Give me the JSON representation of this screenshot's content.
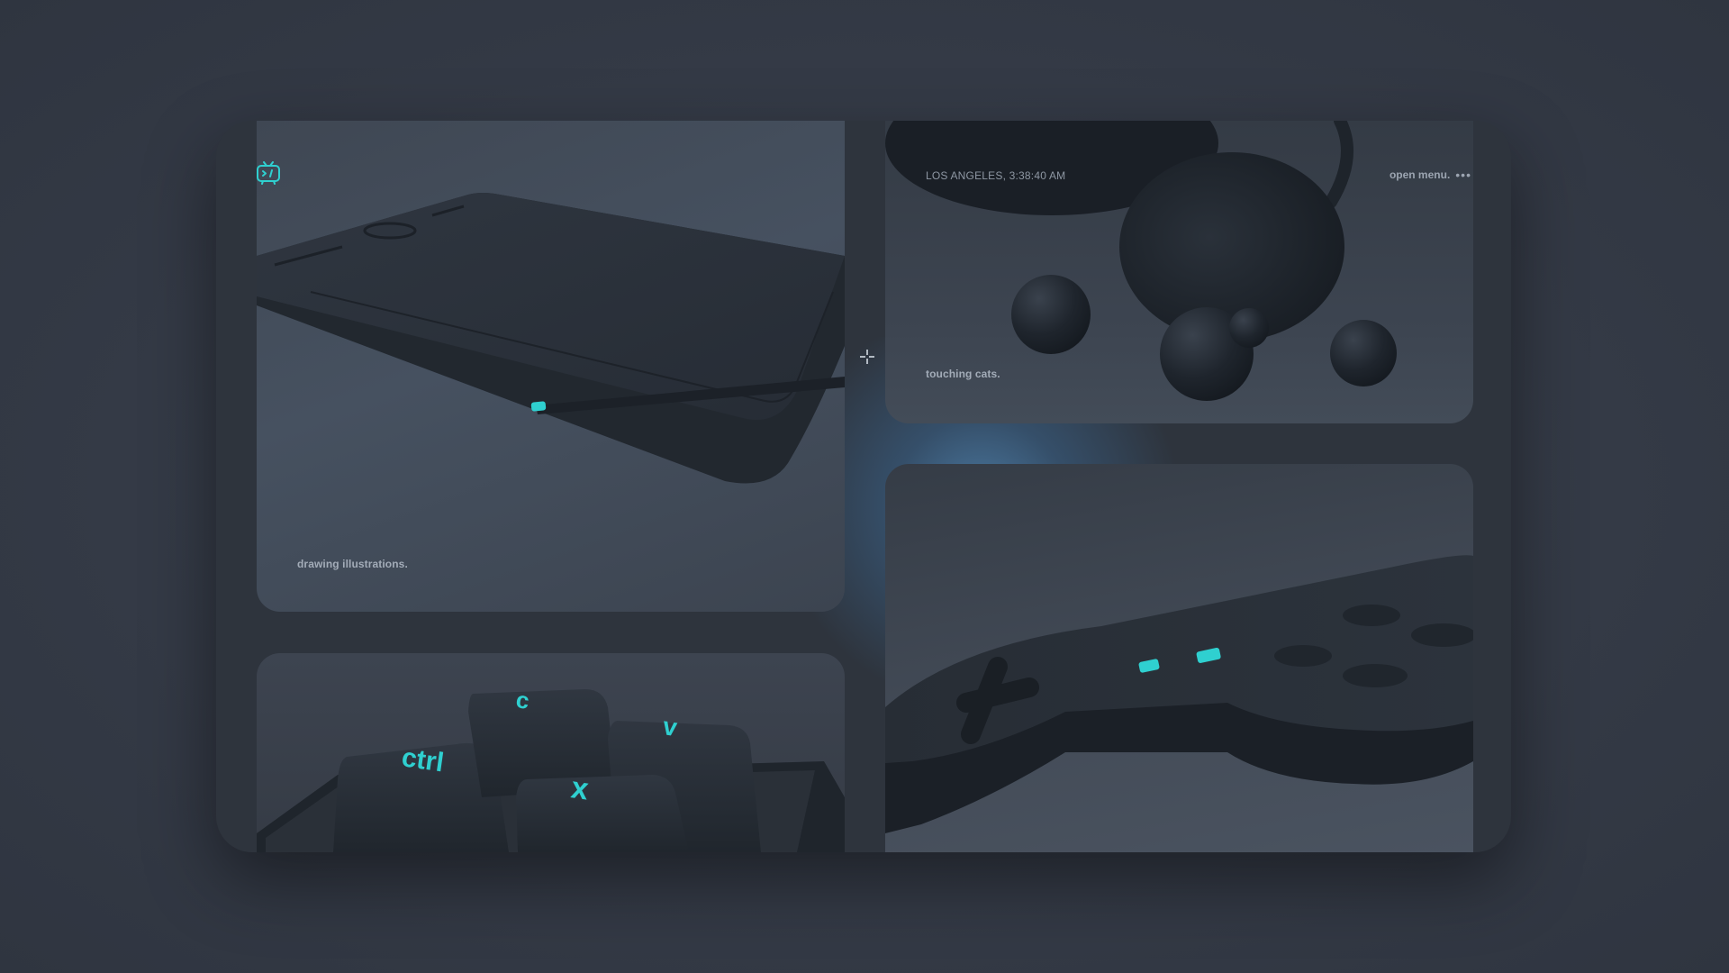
{
  "brand": {
    "logo_icon": "tv-robot-icon",
    "accent": "#2fd0d0"
  },
  "header": {
    "location_time": "LOS ANGELES, 3:38:40 AM",
    "menu_label": "open menu.",
    "menu_icon": "more-dots-icon",
    "menu_dots": "•••"
  },
  "panels": {
    "tablet": {
      "caption": "drawing illustrations."
    },
    "cats": {
      "caption": "touching cats."
    },
    "keys": {
      "key_ctrl": "ctrl",
      "key_c": "c",
      "key_v": "v",
      "key_x": "x"
    }
  },
  "cursor": {
    "icon": "crosshair-icon"
  },
  "colors": {
    "background": "#353c48",
    "frame": "#2e343d",
    "accent": "#2fd0d0",
    "glow": "#4e8cc2"
  }
}
